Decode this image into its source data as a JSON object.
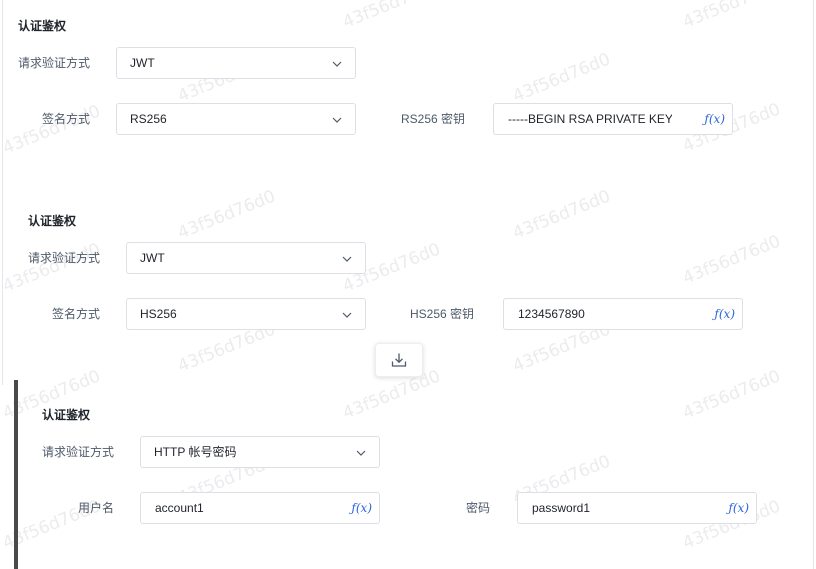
{
  "watermark": "43f56d76d0",
  "panel1": {
    "title": "认证鉴权",
    "auth_method_label": "请求验证方式",
    "auth_method_value": "JWT",
    "sign_method_label": "签名方式",
    "sign_method_value": "RS256",
    "key_label": "RS256 密钥",
    "key_value": "-----BEGIN RSA PRIVATE KEY-----",
    "fx_label": "ƒ(x)"
  },
  "panel2": {
    "title": "认证鉴权",
    "auth_method_label": "请求验证方式",
    "auth_method_value": "JWT",
    "sign_method_label": "签名方式",
    "sign_method_value": "HS256",
    "key_label": "HS256 密钥",
    "key_value": "1234567890",
    "fx_label": "ƒ(x)"
  },
  "panel3": {
    "title": "认证鉴权",
    "auth_method_label": "请求验证方式",
    "auth_method_value": "HTTP 帐号密码",
    "username_label": "用户名",
    "username_value": "account1",
    "password_label": "密码",
    "password_value": "password1",
    "fx_label": "ƒ(x)"
  },
  "icons": {
    "download": "download-icon",
    "chevron": "chevron-down-icon",
    "fx": "function-icon"
  }
}
